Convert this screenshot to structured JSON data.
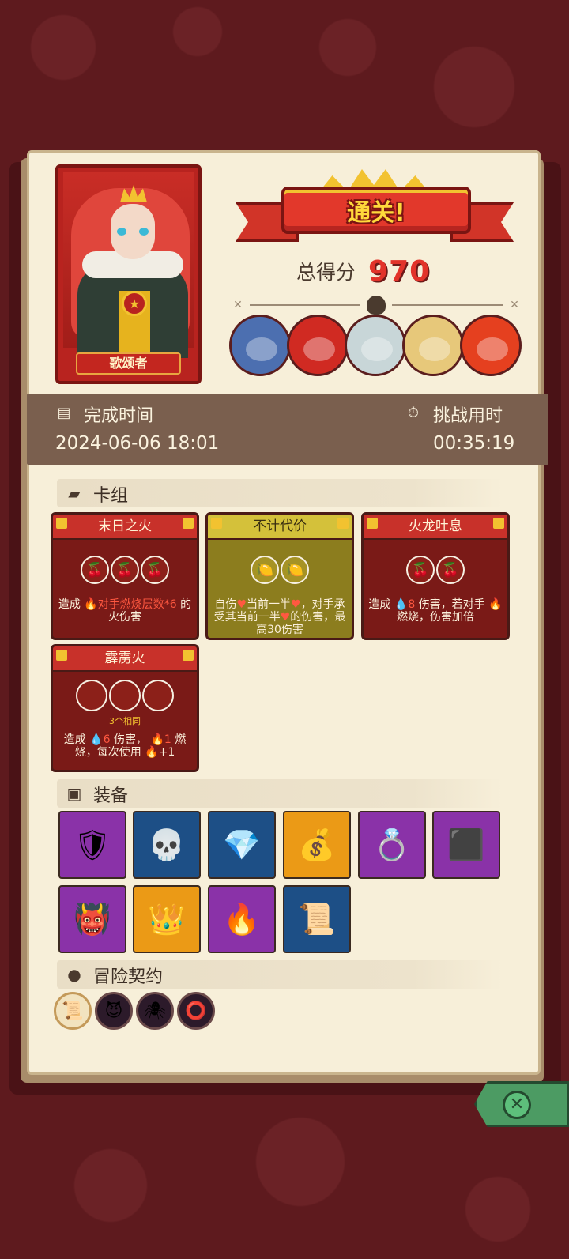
{
  "hero": {
    "name": "歌颂者"
  },
  "result": {
    "title": "通关!",
    "score_label": "总得分",
    "score_value": "970"
  },
  "bosses": [
    "mushroom-elder",
    "red-demon",
    "furry-yeti",
    "tribal-mask",
    "fire-beast"
  ],
  "time": {
    "finish_label": "完成时间",
    "finish_value": "2024-06-06 18:01",
    "challenge_label": "挑战用时",
    "challenge_value": "00:35:19"
  },
  "deck": {
    "title": "卡组",
    "cards": [
      {
        "title": "末日之火",
        "slots": 3,
        "text_a": "造成",
        "text_b": "对手燃烧层数*6",
        "text_c": "的火伤害"
      },
      {
        "title": "不计代价",
        "slots": 2,
        "text_a": "自伤",
        "text_b": "当前一半",
        "text_c": "，对手承受其当前一半",
        "text_d": "的伤害，最高30伤害"
      },
      {
        "title": "火龙吐息",
        "slots": 2,
        "text_a": "造成",
        "text_b": "8",
        "text_c": "伤害，若对手",
        "text_d": "燃烧，伤害加倍"
      },
      {
        "title": "霹雳火",
        "slots": 3,
        "sub": "3个相同",
        "text_a": "造成",
        "text_b": "6",
        "text_c": "伤害，",
        "text_d": "1",
        "text_e": "燃烧，每次使用",
        "text_f": "+1"
      }
    ]
  },
  "equipment": {
    "title": "装备",
    "items": [
      "bracer",
      "horned-skull",
      "emerald",
      "coin-sack",
      "leaf-ring",
      "cube",
      "demon-mask",
      "gold-crown",
      "flame-crown",
      "scroll"
    ]
  },
  "contracts": {
    "title": "冒险契约",
    "items": [
      "scroll",
      "demon",
      "spider",
      "rune"
    ]
  },
  "colors": {
    "accent_red": "#e2332a",
    "panel": "#f7efd9",
    "timebar": "#7a5f4e"
  }
}
